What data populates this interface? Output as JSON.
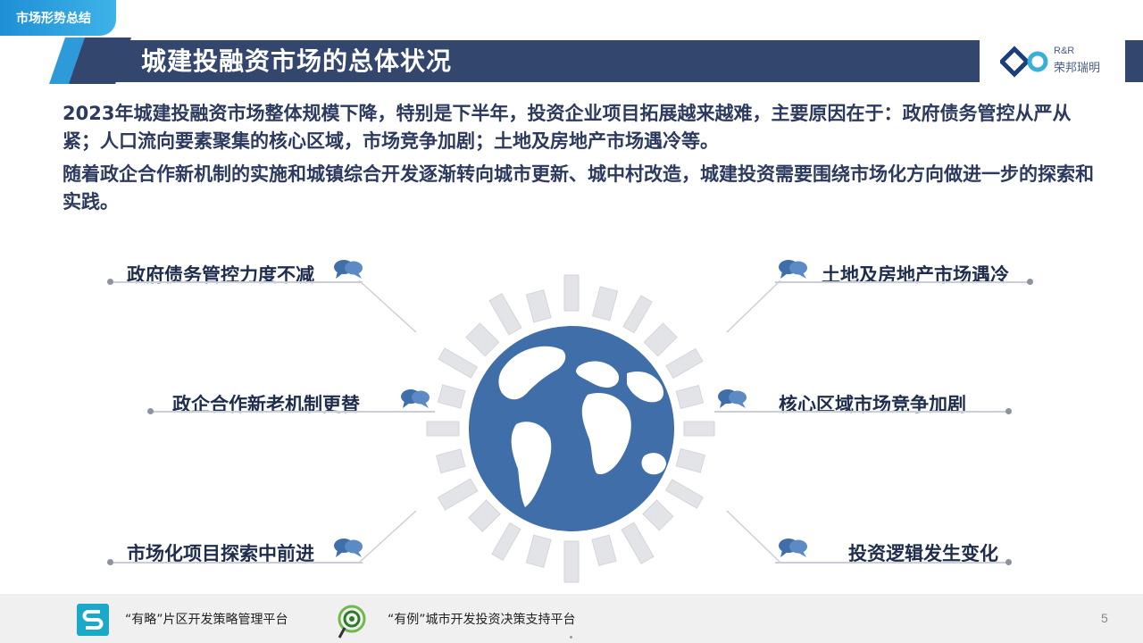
{
  "section_tag": "市场形势总结",
  "title": "城建投融资市场的总体状况",
  "logo": {
    "line1": "R&R",
    "line2": "荣邦瑞明"
  },
  "paragraphs": [
    "2023年城建投融资市场整体规模下降，特别是下半年，投资企业项目拓展越来越难，主要原因在于：政府债务管控从严从紧；人口流向要素聚集的核心区域，市场竞争加剧；土地及房地产市场遇冷等。",
    "随着政企合作新机制的实施和城镇综合开发逐渐转向城市更新、城中村改造，城建投资需要围绕市场化方向做进一步的探索和实践。"
  ],
  "factors": {
    "left": [
      "政府债务管控力度不减",
      "政企合作新老机制更替",
      "市场化项目探索中前进"
    ],
    "right": [
      "土地及房地产市场遇冷",
      "核心区域市场竞争加剧",
      "投资逻辑发生变化"
    ]
  },
  "footer": {
    "platform1": "“有略”片区开发策略管理平台",
    "platform2": "“有例”城市开发投资决策支持平台",
    "page_number": "5"
  },
  "colors": {
    "title_bar": "#33466e",
    "accent": "#1e8fd6",
    "globe": "#3f6ea8",
    "footer_bg": "#f0f0f0"
  },
  "icons": [
    "chat-bubbles-icon",
    "globe-icon",
    "logo-icon",
    "s-platform-icon",
    "magnifier-platform-icon"
  ]
}
